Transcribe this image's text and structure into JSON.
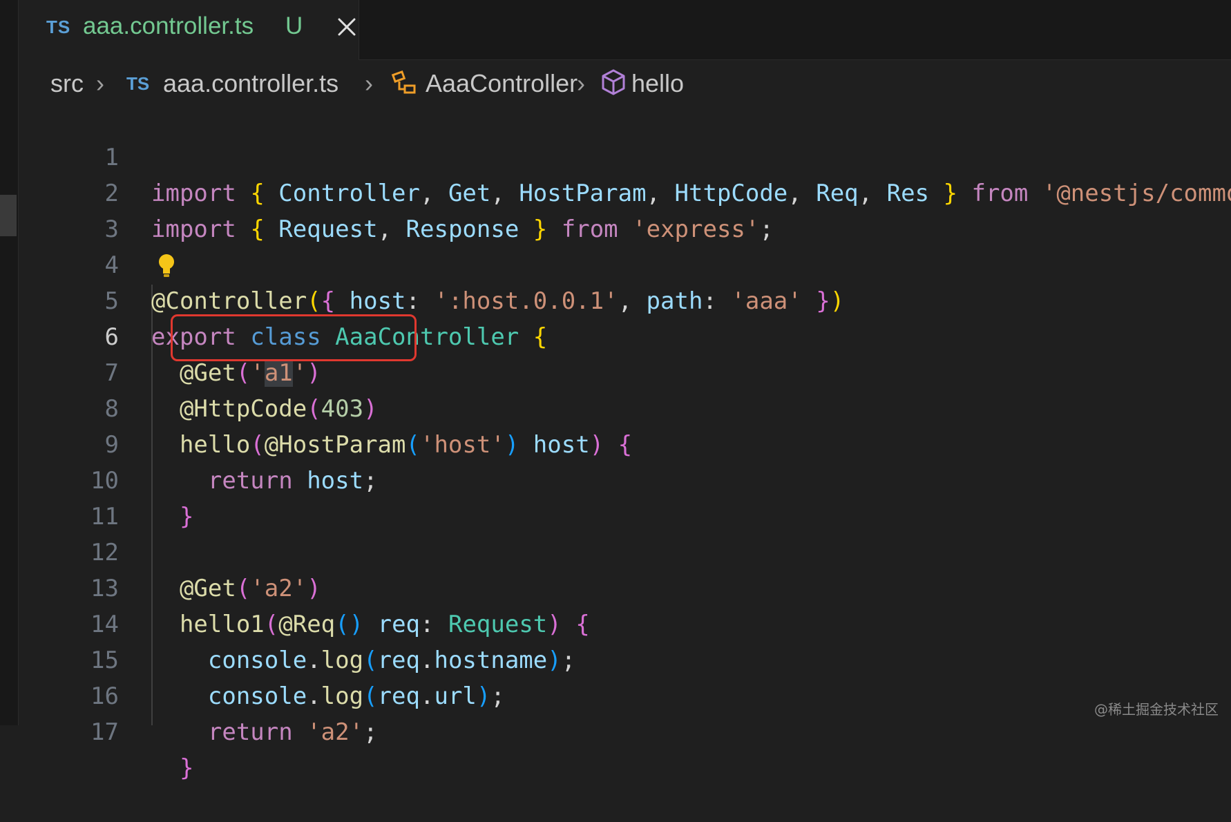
{
  "tab": {
    "type_badge": "TS",
    "filename": "aaa.controller.ts",
    "status": "U"
  },
  "breadcrumb": {
    "folder": "src",
    "file_badge": "TS",
    "file": "aaa.controller.ts",
    "class": "AaaController",
    "method": "hello"
  },
  "editor": {
    "active_line": 6,
    "line_numbers": [
      "1",
      "2",
      "3",
      "4",
      "5",
      "6",
      "7",
      "8",
      "9",
      "10",
      "11",
      "12",
      "13",
      "14",
      "15",
      "16",
      "17"
    ]
  },
  "watermark": "@稀土掘金技术社区",
  "colors": {
    "highlight_box": "#e0382f",
    "keyword": "#c586c0",
    "string": "#ce9178"
  }
}
